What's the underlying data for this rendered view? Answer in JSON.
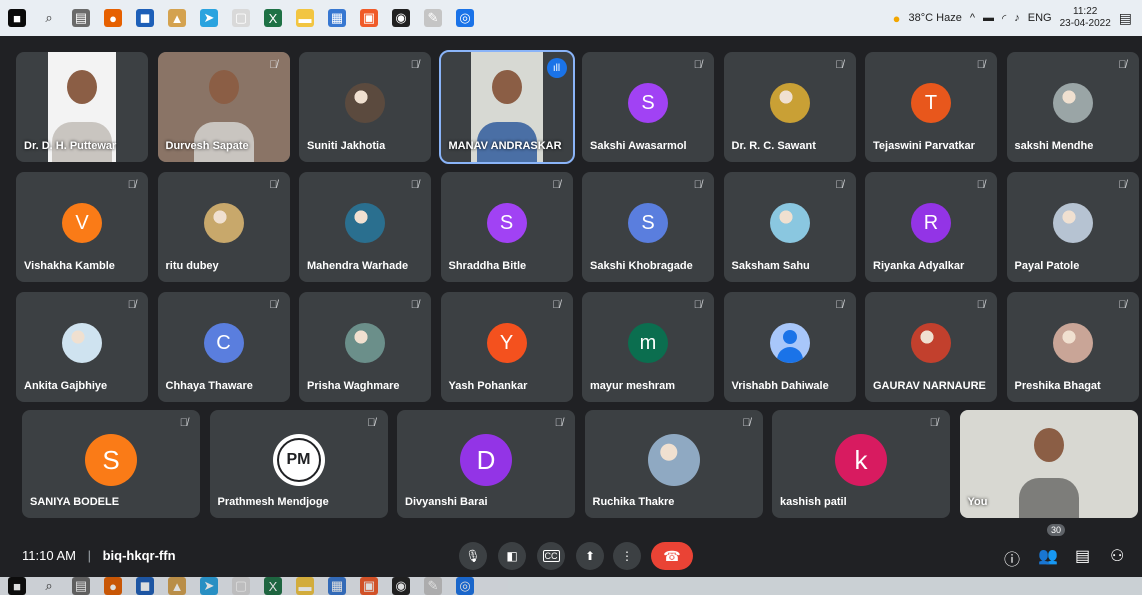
{
  "taskbar": {
    "icons": [
      {
        "name": "windows-start-icon",
        "color": "#0a0a0a",
        "glyph": "■"
      },
      {
        "name": "search-icon",
        "color": "#e9eef3",
        "glyph": "⌕"
      },
      {
        "name": "calculator-icon",
        "color": "#6a6a6a",
        "glyph": "▤"
      },
      {
        "name": "firefox-icon",
        "color": "#e66000",
        "glyph": "●"
      },
      {
        "name": "app-icon",
        "color": "#1d5fb8",
        "glyph": "◼"
      },
      {
        "name": "app-icon",
        "color": "#d4a24f",
        "glyph": "▲"
      },
      {
        "name": "telegram-icon",
        "color": "#2aa3df",
        "glyph": "➤"
      },
      {
        "name": "chat-icon",
        "color": "#d9d9d9",
        "glyph": "▢"
      },
      {
        "name": "excel-icon",
        "color": "#1e7145",
        "glyph": "X"
      },
      {
        "name": "folder-icon",
        "color": "#f2c541",
        "glyph": "▬"
      },
      {
        "name": "app-icon",
        "color": "#3777d1",
        "glyph": "▦"
      },
      {
        "name": "app-icon",
        "color": "#f05a28",
        "glyph": "▣"
      },
      {
        "name": "app-icon",
        "color": "#202020",
        "glyph": "◉"
      },
      {
        "name": "app-icon",
        "color": "#c5c5c5",
        "glyph": "✎"
      },
      {
        "name": "chrome-icon",
        "color": "#1a73e8",
        "glyph": "◎"
      }
    ],
    "weather": "38°C Haze",
    "language": "ENG",
    "time": "11:22",
    "date": "23-04-2022"
  },
  "meeting": {
    "time": "11:10 AM",
    "code": "biq-hkqr-ffn",
    "participant_count": "30"
  },
  "tiles": [
    {
      "name": "Dr. D. H. Puttewar",
      "type": "video",
      "bg": "#f3f3f3",
      "muted": false
    },
    {
      "name": "Durvesh Sapate",
      "type": "video",
      "bg": "#8a7466",
      "muted": true
    },
    {
      "name": "Suniti Jakhotia",
      "type": "photo",
      "color": "#5b4a3e",
      "muted": true
    },
    {
      "name": "MANAV ANDRASKAR",
      "type": "video",
      "bg": "#d7d9d3",
      "muted": false,
      "active": true
    },
    {
      "name": "Sakshi Awasarmol",
      "type": "letter",
      "letter": "S",
      "color": "#a142f4",
      "muted": true
    },
    {
      "name": "Dr. R. C. Sawant",
      "type": "photo",
      "color": "#c9a035",
      "muted": true
    },
    {
      "name": "Tejaswini Parvatkar",
      "type": "letter",
      "letter": "T",
      "color": "#e8571c",
      "muted": true
    },
    {
      "name": "sakshi Mendhe",
      "type": "photo",
      "color": "#9aa5a6",
      "muted": true
    },
    {
      "name": "Vishakha Kamble",
      "type": "letter",
      "letter": "V",
      "color": "#fa7b17",
      "muted": true
    },
    {
      "name": "ritu dubey",
      "type": "photo",
      "color": "#c8a86b",
      "muted": true
    },
    {
      "name": "Mahendra Warhade",
      "type": "photo",
      "color": "#2a6f8f",
      "muted": true
    },
    {
      "name": "Shraddha Bitle",
      "type": "letter",
      "letter": "S",
      "color": "#a142f4",
      "muted": true
    },
    {
      "name": "Sakshi Khobragade",
      "type": "letter",
      "letter": "S",
      "color": "#5a7ede",
      "muted": true
    },
    {
      "name": "Saksham Sahu",
      "type": "photo",
      "color": "#8ac7e0",
      "muted": true
    },
    {
      "name": "Riyanka Adyalkar",
      "type": "letter",
      "letter": "R",
      "color": "#9334e6",
      "muted": true
    },
    {
      "name": "Payal Patole",
      "type": "photo",
      "color": "#b6c3d2",
      "muted": true
    },
    {
      "name": "Ankita Gajbhiye",
      "type": "photo",
      "color": "#cfe3f0",
      "muted": true
    },
    {
      "name": "Chhaya Thaware",
      "type": "letter",
      "letter": "C",
      "color": "#5a7ede",
      "muted": true
    },
    {
      "name": "Prisha Waghmare",
      "type": "photo",
      "color": "#6b8f8a",
      "muted": true
    },
    {
      "name": "Yash Pohankar",
      "type": "letter",
      "letter": "Y",
      "color": "#f4511e",
      "muted": true
    },
    {
      "name": "mayur meshram",
      "type": "letter",
      "letter": "m",
      "color": "#0b6e4f",
      "muted": true
    },
    {
      "name": "Vrishabh Dahiwale",
      "type": "generic",
      "color": "#a8c7fa",
      "muted": true
    },
    {
      "name": "GAURAV NARNAURE",
      "type": "photo",
      "color": "#c2402d",
      "muted": true
    },
    {
      "name": "Preshika Bhagat",
      "type": "photo",
      "color": "#c9a597",
      "muted": true
    },
    {
      "name": "SANIYA BODELE",
      "type": "letter",
      "letter": "S",
      "color": "#fa7b17",
      "muted": true
    },
    {
      "name": "Prathmesh Mendjoge",
      "type": "pm",
      "letter": "PM",
      "color": "#202124",
      "muted": true
    },
    {
      "name": "Divyanshi Barai",
      "type": "letter",
      "letter": "D",
      "color": "#9334e6",
      "muted": true
    },
    {
      "name": "Ruchika Thakre",
      "type": "photo",
      "color": "#8fa9c2",
      "muted": true
    },
    {
      "name": "kashish patil",
      "type": "letter",
      "letter": "k",
      "color": "#d81b60",
      "muted": true
    },
    {
      "name": "You",
      "type": "video",
      "bg": "#d8d8d2",
      "muted": false
    }
  ]
}
